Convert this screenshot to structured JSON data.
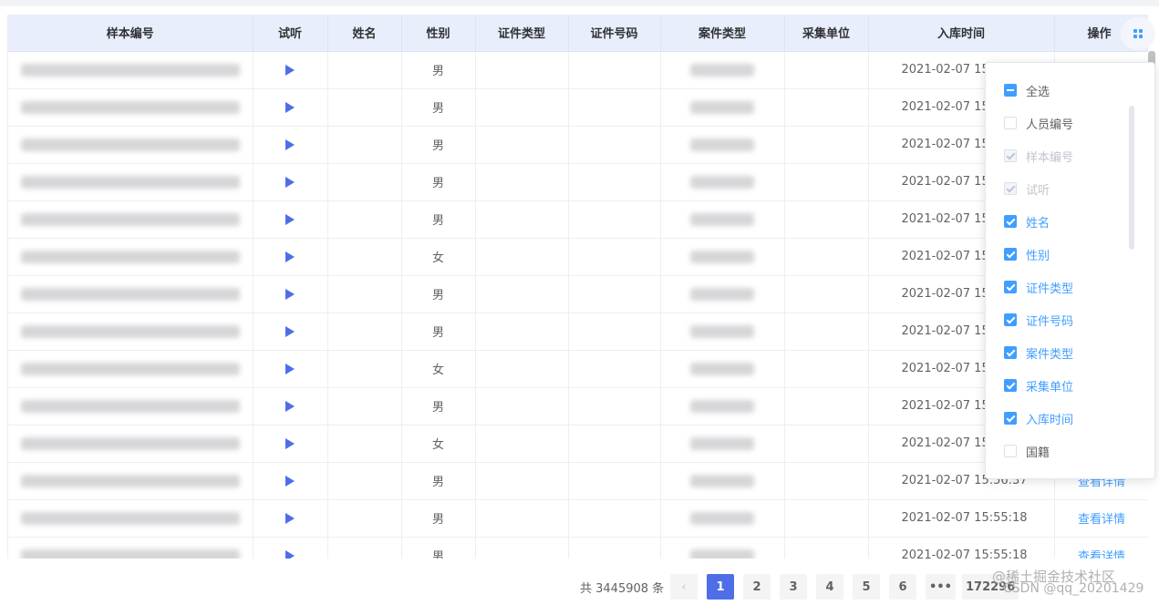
{
  "table": {
    "columns": [
      "样本编号",
      "试听",
      "姓名",
      "性别",
      "证件类型",
      "证件号码",
      "案件类型",
      "采集单位",
      "入库时间",
      "操作"
    ],
    "rows": [
      {
        "gender": "男",
        "time": "2021-02-07 15",
        "action": ""
      },
      {
        "gender": "男",
        "time": "2021-02-07 15",
        "action": ""
      },
      {
        "gender": "男",
        "time": "2021-02-07 15",
        "action": ""
      },
      {
        "gender": "男",
        "time": "2021-02-07 15",
        "action": ""
      },
      {
        "gender": "男",
        "time": "2021-02-07 15",
        "action": ""
      },
      {
        "gender": "女",
        "time": "2021-02-07 15",
        "action": ""
      },
      {
        "gender": "男",
        "time": "2021-02-07 15",
        "action": ""
      },
      {
        "gender": "男",
        "time": "2021-02-07 15",
        "action": ""
      },
      {
        "gender": "女",
        "time": "2021-02-07 15",
        "action": ""
      },
      {
        "gender": "男",
        "time": "2021-02-07 15",
        "action": ""
      },
      {
        "gender": "女",
        "time": "2021-02-07 15",
        "action": ""
      },
      {
        "gender": "男",
        "time": "2021-02-07 15:56:37",
        "action": "查看详情"
      },
      {
        "gender": "男",
        "time": "2021-02-07 15:55:18",
        "action": "查看详情"
      },
      {
        "gender": "男",
        "time": "2021-02-07 15:55:18",
        "action": "查看详情"
      }
    ]
  },
  "column_picker": {
    "icon": "grid-icon",
    "items": [
      {
        "label": "全选",
        "state": "indeterminate"
      },
      {
        "label": "人员编号",
        "state": "unchecked"
      },
      {
        "label": "样本编号",
        "state": "disabled"
      },
      {
        "label": "试听",
        "state": "disabled"
      },
      {
        "label": "姓名",
        "state": "checked"
      },
      {
        "label": "性别",
        "state": "checked"
      },
      {
        "label": "证件类型",
        "state": "checked"
      },
      {
        "label": "证件号码",
        "state": "checked"
      },
      {
        "label": "案件类型",
        "state": "checked"
      },
      {
        "label": "采集单位",
        "state": "checked"
      },
      {
        "label": "入库时间",
        "state": "checked"
      },
      {
        "label": "国籍",
        "state": "unchecked"
      }
    ]
  },
  "pagination": {
    "total": "共 3445908 条",
    "prev": "‹",
    "pages": [
      "1",
      "2",
      "3",
      "4",
      "5",
      "6"
    ],
    "active_page": "1",
    "ellipsis": "•••",
    "last": "172296"
  },
  "watermark": {
    "line1": "@稀土掘金技术社区",
    "line2": "CSDN @qq_20201429"
  },
  "colors": {
    "accent": "#409eff",
    "header_bg": "#e8eefc",
    "play": "#4e6ee8",
    "active_page": "#4e6ee8"
  }
}
